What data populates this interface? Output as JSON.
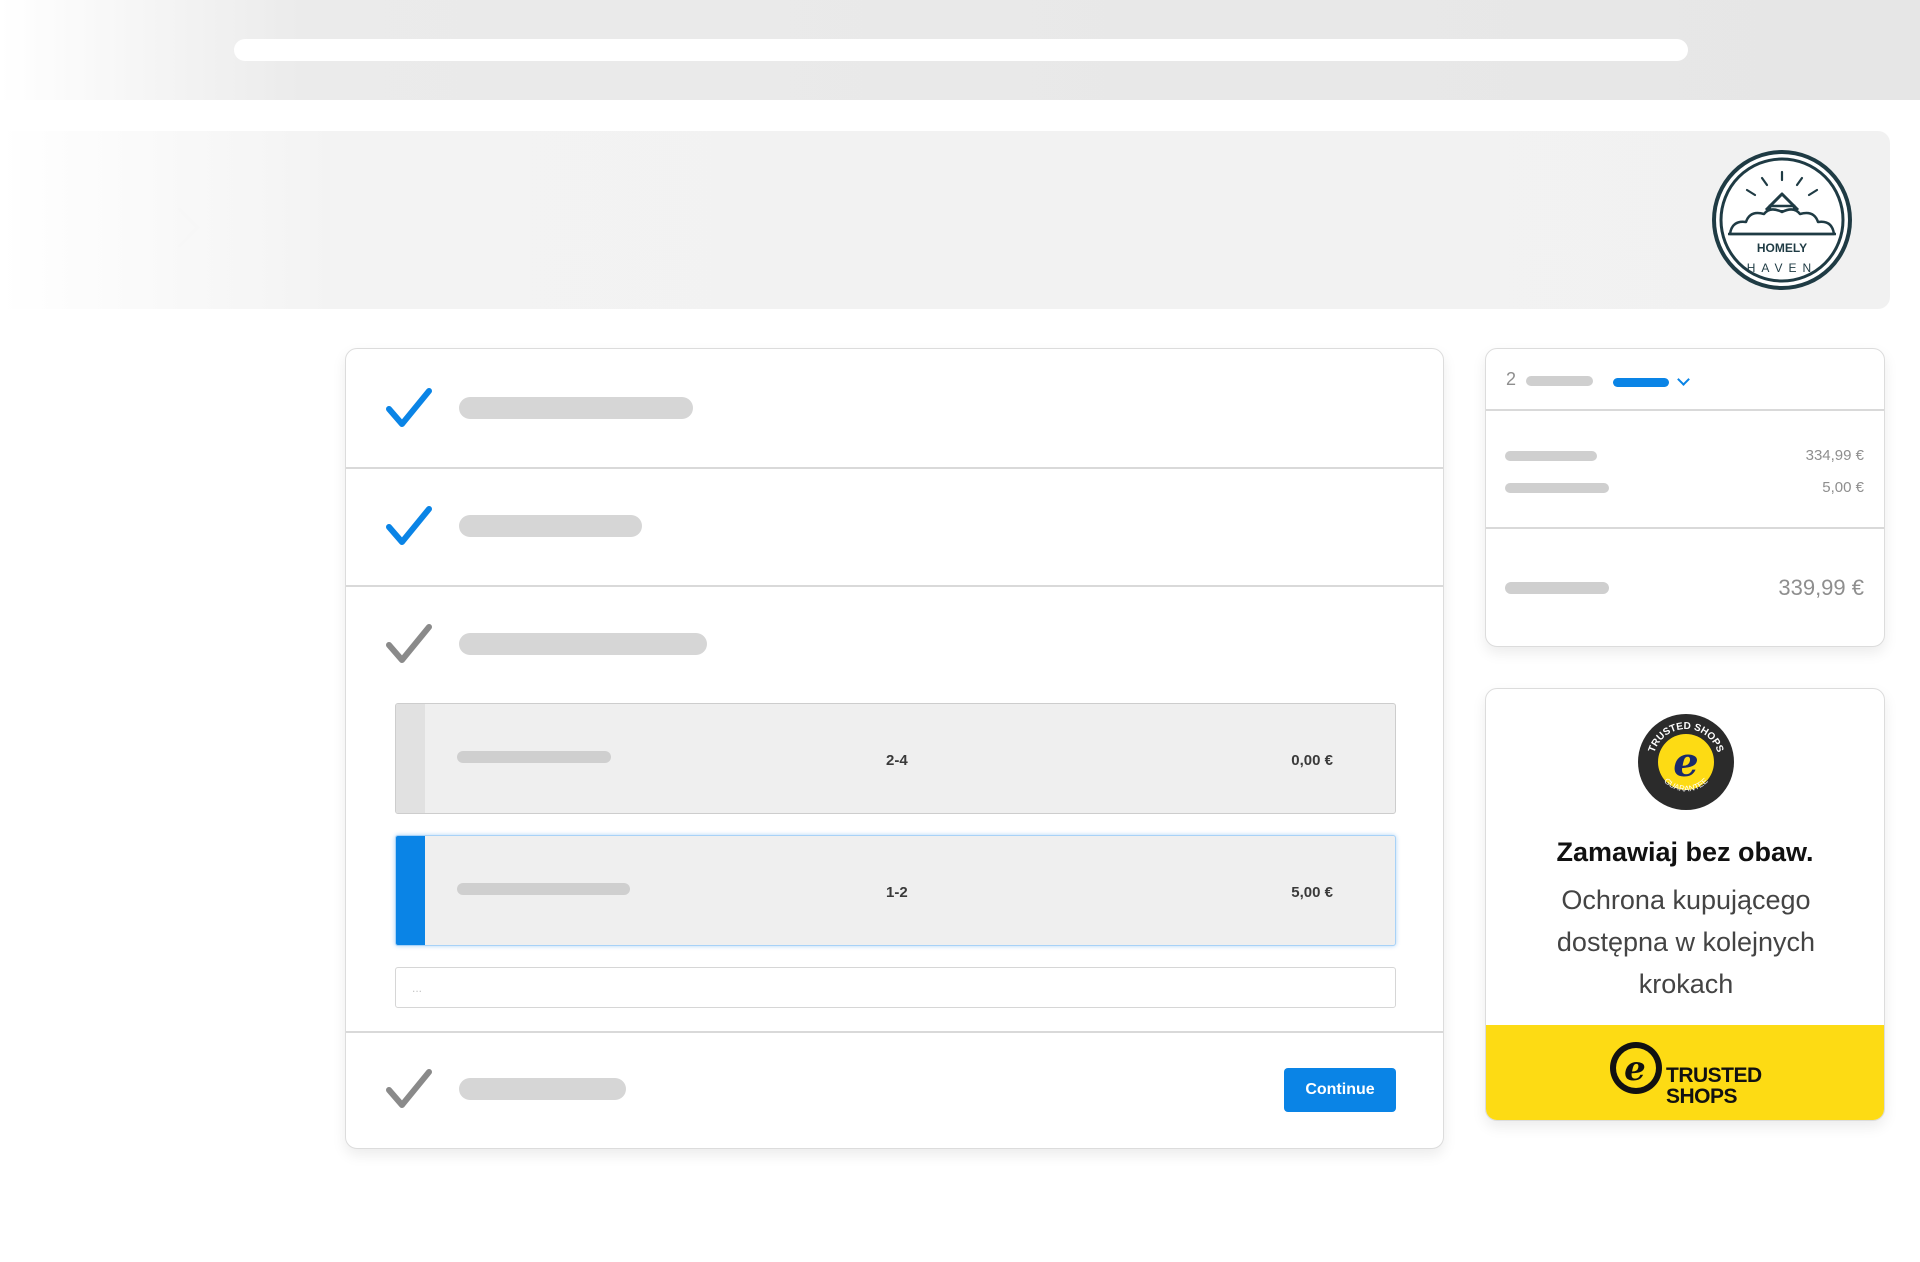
{
  "shop": {
    "logo_top": "HOMELY",
    "logo_bottom": "HAVEN"
  },
  "shipping_options": [
    {
      "delivery_days": "2-4",
      "price": "0,00 €",
      "selected": false
    },
    {
      "delivery_days": "1-2",
      "price": "5,00 €",
      "selected": true
    }
  ],
  "comment": {
    "placeholder": "..."
  },
  "continue_label": "Continue",
  "summary": {
    "item_count": "2",
    "subtotal": "334,99 €",
    "shipping": "5,00 €",
    "total": "339,99 €"
  },
  "trust": {
    "headline": "Zamawiaj bez obaw.",
    "text": "Ochrona kupującego dostępna w kolejnych krokach",
    "seal_top": "TRUSTED SHOPS",
    "seal_bottom": "GUARANTEE",
    "logo_line1": "TRUSTED",
    "logo_line2": "SHOPS"
  },
  "colors": {
    "accent": "#0a84e6",
    "trust_yellow": "#fddb14",
    "check_done": "#0a84e6",
    "check_pending": "#8a8a8a"
  }
}
